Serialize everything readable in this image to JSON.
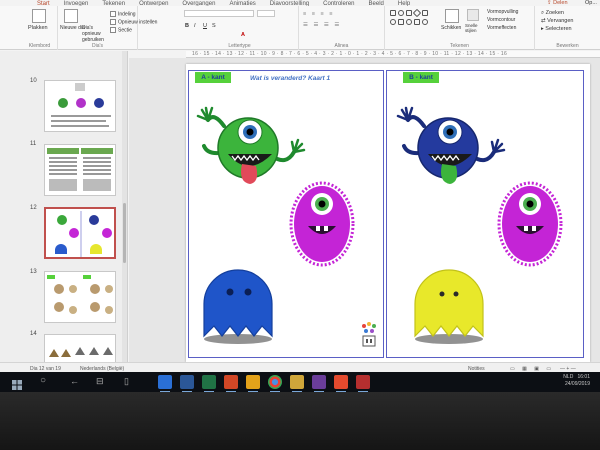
{
  "ribbon_tabs": [
    "Start",
    "Invoegen",
    "Tekenen",
    "Ontwerpen",
    "Overgangen",
    "Animaties",
    "Diavoorstelling",
    "Controleren",
    "Beeld",
    "Help"
  ],
  "ribbon": {
    "clipboard": {
      "paste_label": "Plakken",
      "group_label": "Klembord"
    },
    "slides": {
      "new_slide_label": "Nieuwe dia",
      "reuse_label": "Dia's opnieuw gebruiken",
      "layout_label": "Indeling",
      "reset_label": "Opnieuw instellen",
      "section_label": "Sectie",
      "group_label": "Dia's"
    },
    "font": {
      "group_label": "Lettertype",
      "bold": "B",
      "italic": "I",
      "underline": "U",
      "strike": "S"
    },
    "paragraph": {
      "group_label": "Alinea"
    },
    "drawing": {
      "group_label": "Tekenen",
      "arrange_label": "Schikken",
      "quick_styles_label": "Snelle stijlen",
      "shape_fill_label": "Vormopvulling",
      "shape_outline_label": "Vormcontour",
      "shape_effects_label": "Vormeffecten"
    },
    "editing": {
      "group_label": "Bewerken",
      "find_label": "Zoeken",
      "replace_label": "Vervangen",
      "select_label": "Selecteren"
    },
    "share_label": "Delen",
    "share_label2": "Op..."
  },
  "ruler_text": "16 · 15 · 14 · 13 · 12 · 11 · 10 · 9 · 8 · 7 · 6 · 5 · 4 · 3 · 2 · 1 · 0 · 1 · 2 · 3 · 4 · 5 · 6 · 7 · 8 · 9 · 10 · 11 · 12 · 13 · 14 · 15 · 16",
  "thumbnails": [
    {
      "number": "10",
      "active": false
    },
    {
      "number": "11",
      "active": false
    },
    {
      "number": "12",
      "active": true
    },
    {
      "number": "13",
      "active": false
    },
    {
      "number": "14",
      "active": false
    }
  ],
  "slide": {
    "left_label": "A - kant",
    "right_label": "B - kant",
    "title": "Wat is veranderd? Kaart 1"
  },
  "statusbar": {
    "slide_info": "Dia 12 van 19",
    "language": "Nederlands (België)",
    "notes_label": "Notities"
  },
  "taskbar": {
    "language": "NLD",
    "time": "16:01",
    "date": "24/09/2019"
  },
  "colors": {
    "accent_red": "#b7472a",
    "label_green": "#56d13b",
    "panel_border": "#5a5fc5",
    "title_blue": "#4472c4"
  }
}
